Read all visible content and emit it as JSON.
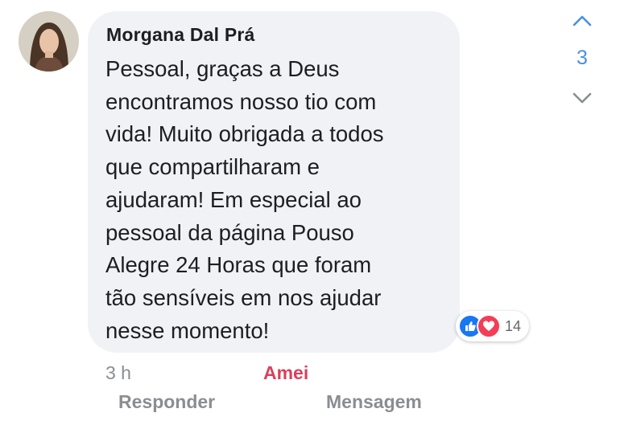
{
  "comment": {
    "author": "Morgana Dal Prá",
    "lines": [
      "Pessoal, graças a Deus",
      "encontramos nosso tio com",
      "vida! Muito obrigada a todos",
      "que compartilharam e",
      "ajudaram! Em especial ao",
      "pessoal da página Pouso",
      "Alegre 24 Horas que foram",
      "tão sensíveis em nos ajudar",
      "nesse momento!"
    ],
    "reactions": {
      "icons": [
        "like-icon",
        "love-icon"
      ],
      "count": "14"
    },
    "time": "3 h",
    "reaction_label": "Amei",
    "reply_label": "Responder",
    "message_label": "Mensagem"
  },
  "navigator": {
    "count": "3",
    "up_icon": "chevron-up-icon",
    "down_icon": "chevron-down-icon"
  },
  "colors": {
    "bubble": "#f0f2f5",
    "love": "#d9405b",
    "link": "#4a90e2",
    "muted": "#8a8d91"
  }
}
